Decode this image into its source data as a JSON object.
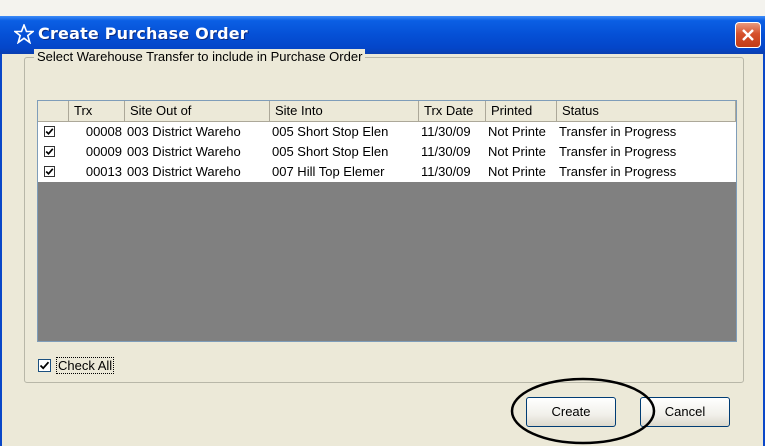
{
  "window": {
    "title": "Create Purchase Order"
  },
  "group": {
    "legend": "Select Warehouse Transfer to include in Purchase Order"
  },
  "table": {
    "headers": [
      "Trx",
      "Site Out of",
      "Site Into",
      "Trx Date",
      "Printed",
      "Status"
    ],
    "rows": [
      {
        "checked": true,
        "cells": [
          "00008",
          "003 District Wareho",
          "005 Short Stop Elen",
          "11/30/09",
          "Not Printe",
          "Transfer in Progress"
        ]
      },
      {
        "checked": true,
        "cells": [
          "00009",
          "003 District Wareho",
          "005 Short Stop Elen",
          "11/30/09",
          "Not Printe",
          "Transfer in Progress"
        ]
      },
      {
        "checked": true,
        "cells": [
          "00013",
          "003 District Wareho",
          "007 Hill Top Elemer",
          "11/30/09",
          "Not Printe",
          "Transfer in Progress"
        ]
      }
    ]
  },
  "check_all": {
    "label": "Check All",
    "checked": true
  },
  "buttons": {
    "create": "Create",
    "cancel": "Cancel"
  },
  "colors": {
    "title_bar": "#0550d6",
    "dialog_bg": "#ece9d8",
    "list_empty_bg": "#808080",
    "close_button": "#d6512c"
  }
}
